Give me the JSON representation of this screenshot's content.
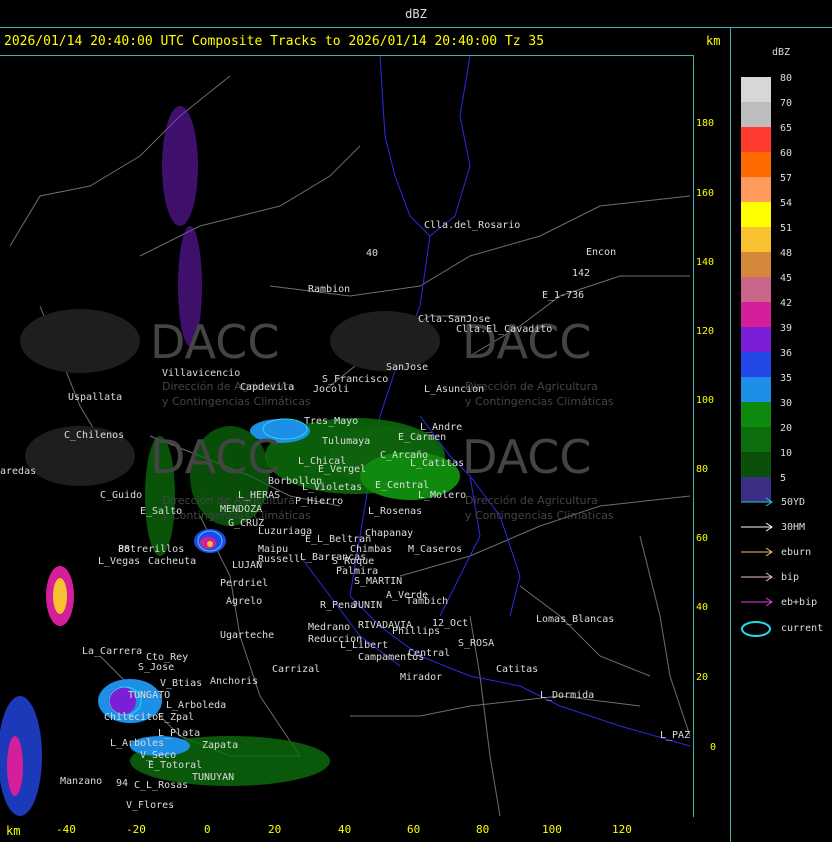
{
  "header": {
    "title": "dBZ"
  },
  "map": {
    "subtitle": "2026/01/14 20:40:00 UTC Composite Tracks to 2026/01/14 20:40:00 Tz 35",
    "km_label_top": "km",
    "km_label_bottom": "km",
    "y_ticks": [
      "180",
      "160",
      "140",
      "120",
      "100",
      "80",
      "60",
      "40",
      "20",
      "0"
    ],
    "x_ticks": [
      "-40",
      "-20",
      "0",
      "20",
      "40",
      "60",
      "80",
      "100",
      "120"
    ],
    "watermark": {
      "brand": "DACC",
      "line1": "Dirección de Agricultura",
      "line2": "y Contingencias Climáticas"
    },
    "places": [
      {
        "name": "Clla.del_Rosario"
      },
      {
        "name": "Encon"
      },
      {
        "name": "142"
      },
      {
        "name": "E_1-736"
      },
      {
        "name": "Rambion"
      },
      {
        "name": "Clla.SanJose"
      },
      {
        "name": "Clla.El_Cavadito"
      },
      {
        "name": "Villavicencio"
      },
      {
        "name": "Capdevila"
      },
      {
        "name": "S_Francisco"
      },
      {
        "name": "SanJose"
      },
      {
        "name": "L_Asuncion"
      },
      {
        "name": "Jocoli"
      },
      {
        "name": "Uspallata"
      },
      {
        "name": "C_Chilenos"
      },
      {
        "name": "Tres_Mayo"
      },
      {
        "name": "Tulumaya"
      },
      {
        "name": "E_Carmen"
      },
      {
        "name": "L_Andre"
      },
      {
        "name": "C_Arcaño"
      },
      {
        "name": "L_Catitas"
      },
      {
        "name": "L_Chical"
      },
      {
        "name": "E_Vergel"
      },
      {
        "name": "Borbollon"
      },
      {
        "name": "L_Violetas"
      },
      {
        "name": "E_Central"
      },
      {
        "name": "L_Molero"
      },
      {
        "name": "P_Hierro"
      },
      {
        "name": "L_Rosenas"
      },
      {
        "name": "aredas"
      },
      {
        "name": "C_Guido"
      },
      {
        "name": "L_HERAS"
      },
      {
        "name": "E_Salto"
      },
      {
        "name": "MENDOZA"
      },
      {
        "name": "G_CRUZ"
      },
      {
        "name": "Luzuriaga"
      },
      {
        "name": "Chapanay"
      },
      {
        "name": "E_L_Beltran"
      },
      {
        "name": "Chimbas"
      },
      {
        "name": "M_Caseros"
      },
      {
        "name": "Potrerillos"
      },
      {
        "name": "L_Vegas"
      },
      {
        "name": "Cacheuta"
      },
      {
        "name": "LUJAN"
      },
      {
        "name": "Maipu"
      },
      {
        "name": "Russell"
      },
      {
        "name": "Perdriel"
      },
      {
        "name": "L_Barrancas"
      },
      {
        "name": "S_Roque"
      },
      {
        "name": "Palmira"
      },
      {
        "name": "S_MARTIN"
      },
      {
        "name": "Agrelo"
      },
      {
        "name": "R_Pena"
      },
      {
        "name": "JUNIN"
      },
      {
        "name": "A_Verde"
      },
      {
        "name": "Tambich"
      },
      {
        "name": "Lomas_Blancas"
      },
      {
        "name": "Ugarteche"
      },
      {
        "name": "Medrano"
      },
      {
        "name": "RIVADAVIA"
      },
      {
        "name": "12_Oct"
      },
      {
        "name": "Phillips"
      },
      {
        "name": "S_ROSA"
      },
      {
        "name": "Reduccion"
      },
      {
        "name": "L_Libert"
      },
      {
        "name": "Campamentos"
      },
      {
        "name": "Central"
      },
      {
        "name": "La_Carrera"
      },
      {
        "name": "Cto_Rey"
      },
      {
        "name": "S_Jose"
      },
      {
        "name": "Carrizal"
      },
      {
        "name": "Catitas"
      },
      {
        "name": "V_Btias"
      },
      {
        "name": "Anchoris"
      },
      {
        "name": "Mirador"
      },
      {
        "name": "TUNGATO"
      },
      {
        "name": "L_Arboleda"
      },
      {
        "name": "L_Dormida"
      },
      {
        "name": "Chilecito"
      },
      {
        "name": "E_Zpal"
      },
      {
        "name": "L_Arboles"
      },
      {
        "name": "L_Plata"
      },
      {
        "name": "Zapata"
      },
      {
        "name": "L_PAZ"
      },
      {
        "name": "V_Seco"
      },
      {
        "name": "E_Totoral"
      },
      {
        "name": "Manzano"
      },
      {
        "name": "94"
      },
      {
        "name": "C_L_Rosas"
      },
      {
        "name": "TUNUYAN"
      },
      {
        "name": "V_Flores"
      },
      {
        "name": "88"
      },
      {
        "name": "40"
      }
    ]
  },
  "legend": {
    "title": "dBZ",
    "levels": [
      {
        "value": "80",
        "color": "#d7d7d7"
      },
      {
        "value": "70",
        "color": "#bdbdbd"
      },
      {
        "value": "65",
        "color": "#ff3b2f"
      },
      {
        "value": "60",
        "color": "#ff6a00"
      },
      {
        "value": "57",
        "color": "#ff9a5a"
      },
      {
        "value": "54",
        "color": "#ffff00"
      },
      {
        "value": "51",
        "color": "#f7c130"
      },
      {
        "value": "48",
        "color": "#d4883a"
      },
      {
        "value": "45",
        "color": "#c9668a"
      },
      {
        "value": "42",
        "color": "#d41f9a"
      },
      {
        "value": "39",
        "color": "#7b1fd6"
      },
      {
        "value": "36",
        "color": "#2247e6"
      },
      {
        "value": "35",
        "color": "#1e8fe6"
      },
      {
        "value": "30",
        "color": "#0f8a0f"
      },
      {
        "value": "20",
        "color": "#0c6e0c"
      },
      {
        "value": "10",
        "color": "#0a4f0a"
      },
      {
        "value": "5",
        "color": "#3a2f85"
      }
    ],
    "tracks": [
      {
        "label": "50YD",
        "color": "#29c8d0"
      },
      {
        "label": "30HM",
        "color": "#ffffff"
      },
      {
        "label": "eburn",
        "color": "#f0c870"
      },
      {
        "label": "bip",
        "color": "#f5c2c2"
      },
      {
        "label": "eb+bip",
        "color": "#e040e0"
      },
      {
        "label": "current",
        "color": "#29d8e8"
      }
    ]
  }
}
